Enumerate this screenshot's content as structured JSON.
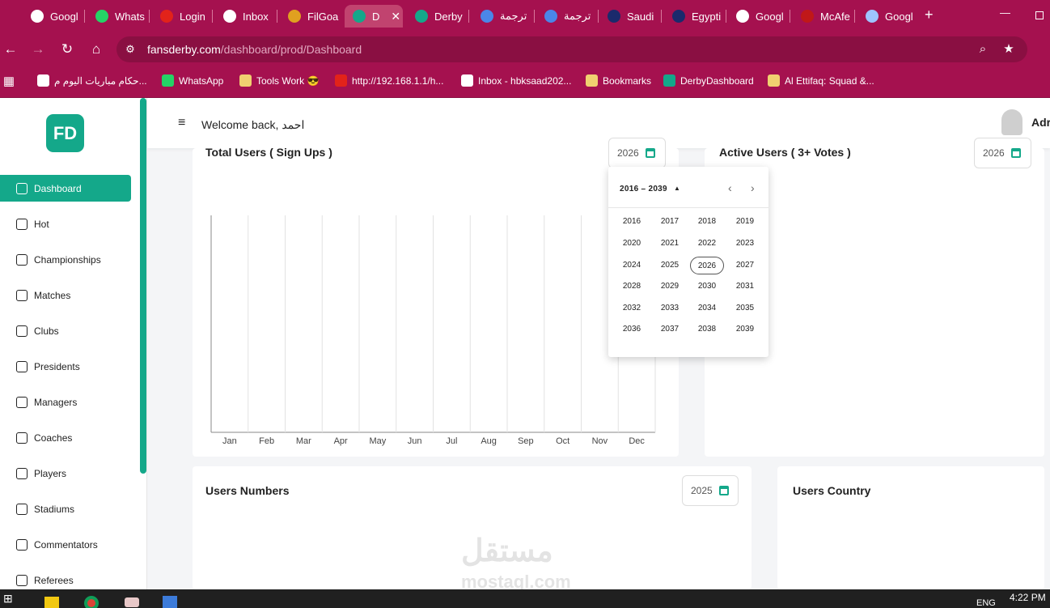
{
  "browser": {
    "tabs": [
      {
        "label": "Googl",
        "icon": "google-icon"
      },
      {
        "label": "Whats",
        "icon": "whatsapp-icon"
      },
      {
        "label": "Login",
        "icon": "huawei-icon"
      },
      {
        "label": "Inbox",
        "icon": "gmail-icon"
      },
      {
        "label": "FilGoa",
        "icon": "filgoal-icon"
      },
      {
        "label": "D",
        "icon": "fd-icon"
      },
      {
        "label": "Derby",
        "icon": "fd-icon"
      },
      {
        "label": "ترجمة",
        "icon": "translate-icon"
      },
      {
        "label": "ترجمة",
        "icon": "translate-icon"
      },
      {
        "label": "Saudi",
        "icon": "tm-icon"
      },
      {
        "label": "Egypti",
        "icon": "tm-icon"
      },
      {
        "label": "Googl",
        "icon": "google-icon"
      },
      {
        "label": "McAfe",
        "icon": "mcafee-icon"
      },
      {
        "label": "Googl",
        "icon": "gemini-icon"
      }
    ],
    "new_tab": "+",
    "minimize": "—",
    "url_host": "fansderby.com",
    "url_path": "/dashboard/prod/Dashboard",
    "bookmarks": [
      {
        "label": "حكام مباريات اليوم م...",
        "icon": "google-icon"
      },
      {
        "label": "WhatsApp",
        "icon": "whatsapp-icon"
      },
      {
        "label": "Tools Work 😎",
        "icon": "folder-icon"
      },
      {
        "label": "http://192.168.1.1/h...",
        "icon": "huawei-icon"
      },
      {
        "label": "Inbox - hbksaad202...",
        "icon": "gmail-icon"
      },
      {
        "label": "Bookmarks",
        "icon": "star-icon"
      },
      {
        "label": "DerbyDashboard",
        "icon": "fd-icon"
      },
      {
        "label": "Al Ettifaq: Squad &...",
        "icon": "365-icon"
      }
    ]
  },
  "app": {
    "logo": "FD",
    "welcome": "Welcome back, احمد",
    "user_short": "Adr",
    "nav": [
      {
        "label": "Dashboard",
        "active": true
      },
      {
        "label": "Hot"
      },
      {
        "label": "Championships"
      },
      {
        "label": "Matches"
      },
      {
        "label": "Clubs"
      },
      {
        "label": "Presidents"
      },
      {
        "label": "Managers"
      },
      {
        "label": "Coaches"
      },
      {
        "label": "Players"
      },
      {
        "label": "Stadiums"
      },
      {
        "label": "Commentators"
      },
      {
        "label": "Referees"
      }
    ],
    "cards": {
      "total_users": {
        "title": "Total Users ( Sign Ups )",
        "year": "2026"
      },
      "active_users": {
        "title": "Active Users ( 3+ Votes )",
        "year": "2026"
      },
      "users_numbers": {
        "title": "Users Numbers",
        "year": "2025"
      },
      "users_country": {
        "title": "Users Country"
      }
    },
    "year_picker": {
      "range_label": "2016 – 2039",
      "selected": "2026",
      "years": [
        "2016",
        "2017",
        "2018",
        "2019",
        "2020",
        "2021",
        "2022",
        "2023",
        "2024",
        "2025",
        "2026",
        "2027",
        "2028",
        "2029",
        "2030",
        "2031",
        "2032",
        "2033",
        "2034",
        "2035",
        "2036",
        "2037",
        "2038",
        "2039"
      ]
    }
  },
  "chart_data": {
    "type": "bar",
    "title": "Total Users ( Sign Ups )",
    "categories": [
      "Jan",
      "Feb",
      "Mar",
      "Apr",
      "May",
      "Jun",
      "Jul",
      "Aug",
      "Sep",
      "Oct",
      "Nov",
      "Dec"
    ],
    "values": [],
    "grid": true
  },
  "watermark": {
    "arabic": "مستقل",
    "latin": "mostaql.com"
  },
  "taskbar": {
    "time": "4:22 PM",
    "lang": "ENG"
  },
  "colors": {
    "accent": "#14a88a",
    "chrome": "#a5114f"
  }
}
